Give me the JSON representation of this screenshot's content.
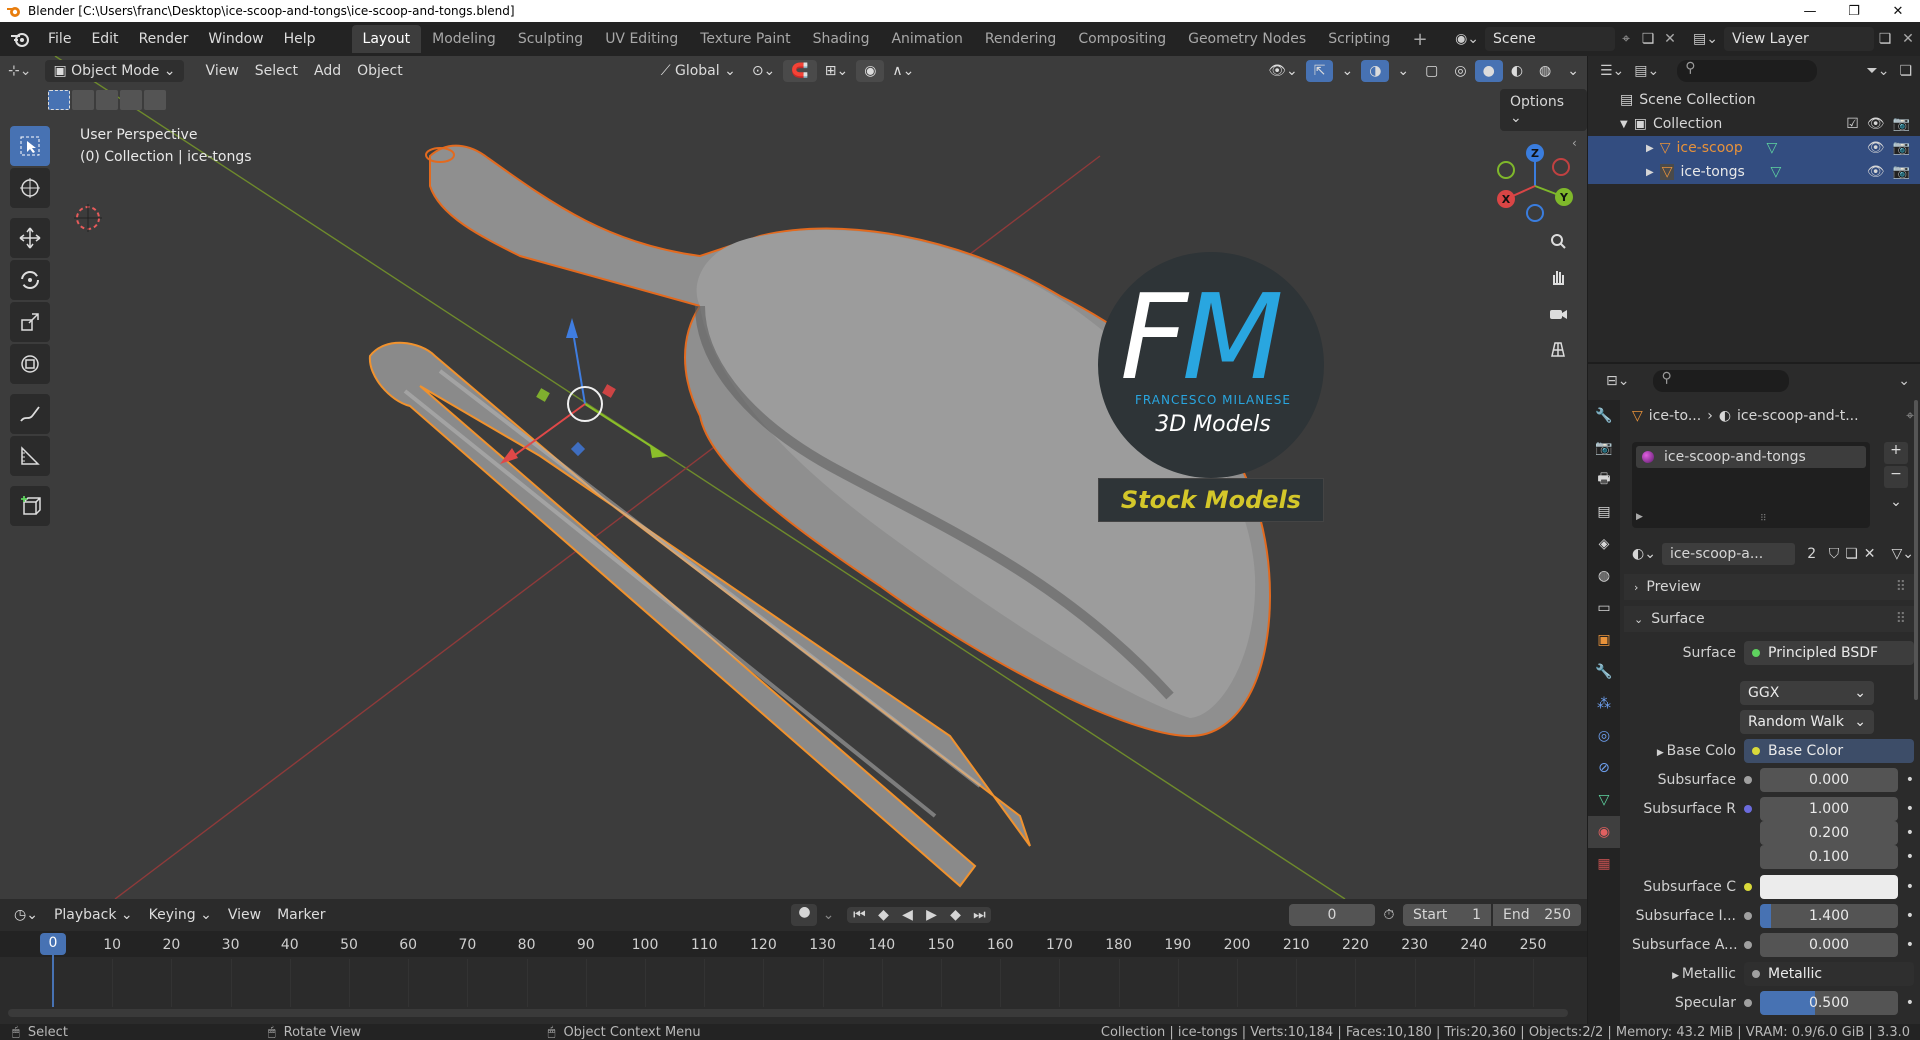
{
  "window": {
    "title": "Blender [C:\\Users\\franc\\Desktop\\ice-scoop-and-tongs\\ice-scoop-and-tongs.blend]"
  },
  "menus": [
    "File",
    "Edit",
    "Render",
    "Window",
    "Help"
  ],
  "workspaces": [
    "Layout",
    "Modeling",
    "Sculpting",
    "UV Editing",
    "Texture Paint",
    "Shading",
    "Animation",
    "Rendering",
    "Compositing",
    "Geometry Nodes",
    "Scripting"
  ],
  "active_workspace": "Layout",
  "scene": {
    "name": "Scene",
    "view_layer": "View Layer"
  },
  "viewport": {
    "mode": "Object Mode",
    "menus": [
      "View",
      "Select",
      "Add",
      "Object"
    ],
    "transform_orientation": "Global",
    "options_label": "Options",
    "perspective_label": "User Perspective",
    "collection_label": "(0) Collection | ice-tongs",
    "gizmo_axes": {
      "x": "X",
      "y": "Y",
      "z": "Z"
    }
  },
  "logo": {
    "letters_f": "F",
    "letters_m": "M",
    "name": "FRANCESCO MILANESE",
    "subtitle": "3D Models",
    "badge": "Stock Models"
  },
  "outliner": {
    "scene_collection": "Scene Collection",
    "collection": "Collection",
    "objects": [
      "ice-scoop",
      "ice-tongs"
    ]
  },
  "properties": {
    "breadcrumb_object": "ice-to...",
    "breadcrumb_material": "ice-scoop-and-t...",
    "material_slot": "ice-scoop-and-tongs",
    "material_name": "ice-scoop-a...",
    "material_users": "2",
    "panels": {
      "preview": "Preview",
      "surface": "Surface"
    },
    "rows": {
      "surface": {
        "label": "Surface",
        "value": "Principled BSDF"
      },
      "distribution": "GGX",
      "subsurface_method": "Random Walk",
      "base_color": {
        "label": "Base Colo",
        "value": "Base Color"
      },
      "subsurface": {
        "label": "Subsurface",
        "value": "0.000"
      },
      "subsurface_radius": {
        "label": "Subsurface R",
        "values": [
          "1.000",
          "0.200",
          "0.100"
        ]
      },
      "subsurface_color": {
        "label": "Subsurface C"
      },
      "subsurface_ior": {
        "label": "Subsurface I...",
        "value": "1.400"
      },
      "subsurface_aniso": {
        "label": "Subsurface A...",
        "value": "0.000"
      },
      "metallic": {
        "label": "Metallic",
        "value": "Metallic"
      },
      "specular": {
        "label": "Specular",
        "value": "0.500"
      }
    }
  },
  "timeline": {
    "menus": [
      "Playback",
      "Keying",
      "View",
      "Marker"
    ],
    "current_frame": "0",
    "start_label": "Start",
    "start_value": "1",
    "end_label": "End",
    "end_value": "250",
    "ruler": [
      "0",
      "10",
      "20",
      "30",
      "40",
      "50",
      "60",
      "70",
      "80",
      "90",
      "100",
      "110",
      "120",
      "130",
      "140",
      "150",
      "160",
      "170",
      "180",
      "190",
      "200",
      "210",
      "220",
      "230",
      "240",
      "250"
    ]
  },
  "statusbar": {
    "select": "Select",
    "rotate": "Rotate View",
    "context": "Object Context Menu",
    "stats": "Collection | ice-tongs | Verts:10,184 | Faces:10,180 | Tris:20,360 | Objects:2/2 | Memory: 43.2 MiB | VRAM: 0.9/6.0 GiB | 3.3.0"
  },
  "colors": {
    "accent": "#4772b3",
    "selection": "#e87d27",
    "logo_blue": "#29a6e0",
    "badge_yellow": "#d4c72a"
  }
}
